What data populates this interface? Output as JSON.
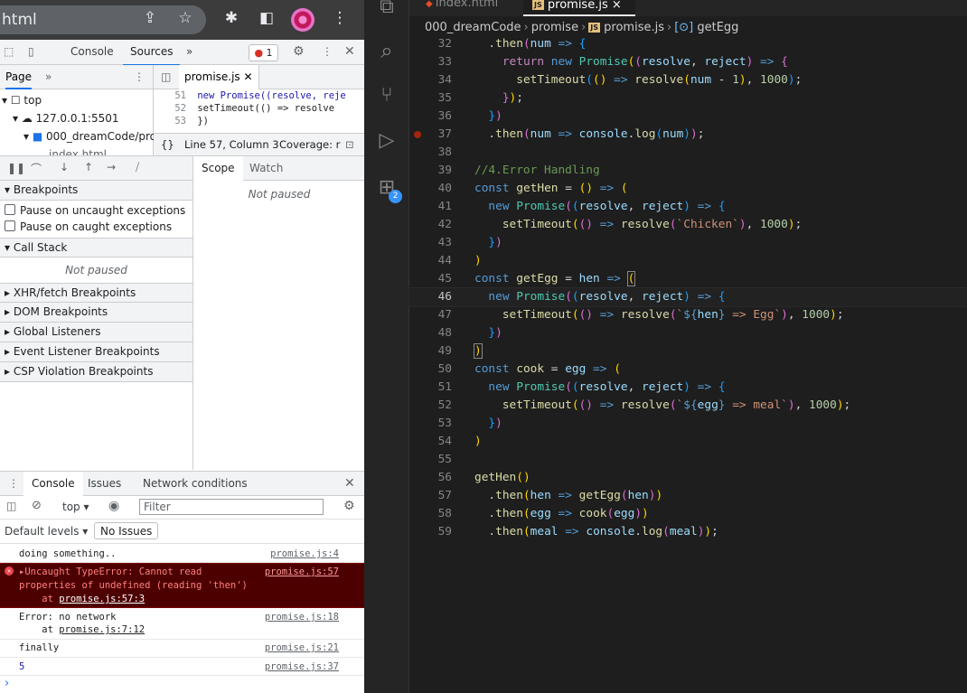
{
  "browser": {
    "omnibox_text": "html",
    "icons": [
      "share-icon",
      "star-icon",
      "extensions-icon",
      "side-panel-icon",
      "profile-avatar",
      "menu-icon"
    ]
  },
  "devtools": {
    "tabs": {
      "console": "Console",
      "sources": "Sources",
      "more": "»"
    },
    "error_count": "1",
    "navigator": {
      "page_tab": "Page",
      "more": "»",
      "tree": [
        {
          "label": "top"
        },
        {
          "label": "127.0.0.1:5501"
        },
        {
          "label": "000_dreamCode/pro"
        },
        {
          "label": "index.html"
        }
      ]
    },
    "editor": {
      "file_tab": "promise.js",
      "lines": [
        {
          "num": "51",
          "code": "  new Promise((resolve, reje"
        },
        {
          "num": "52",
          "code": "    setTimeout(() => resolve"
        },
        {
          "num": "53",
          "code": "  })"
        }
      ],
      "status_position": "Line 57, Column 3",
      "status_coverage": "Coverage: r",
      "status_braces": "{}"
    },
    "scope_tabs": {
      "scope": "Scope",
      "watch": "Watch"
    },
    "scope_not_paused": "Not paused",
    "sections": {
      "breakpoints": "Breakpoints",
      "pause_uncaught": "Pause on uncaught exceptions",
      "pause_caught": "Pause on caught exceptions",
      "call_stack": "Call Stack",
      "call_stack_note": "Not paused",
      "xhr": "XHR/fetch Breakpoints",
      "dom": "DOM Breakpoints",
      "global": "Global Listeners",
      "event": "Event Listener Breakpoints",
      "csp": "CSP Violation Breakpoints"
    },
    "drawer_tabs": {
      "console": "Console",
      "issues": "Issues",
      "network": "Network conditions"
    },
    "console_toolbar": {
      "context": "top",
      "filter_placeholder": "Filter",
      "levels": "Default levels",
      "issues": "No Issues"
    },
    "console_messages": [
      {
        "type": "log",
        "text": "doing something..",
        "source": "promise.js:4"
      },
      {
        "type": "error",
        "text1": "▸Uncaught TypeError: Cannot read",
        "text2": "properties of undefined (reading 'then')",
        "text3_prefix": "    at ",
        "text3_link": "promise.js:57:3",
        "source": "promise.js:57"
      },
      {
        "type": "log",
        "text1": "Error: no network",
        "text2_prefix": "    at ",
        "text2_link": "promise.js:7:12",
        "source": "promise.js:18"
      },
      {
        "type": "log",
        "text": "finally",
        "source": "promise.js:21"
      },
      {
        "type": "number",
        "text": "5",
        "source": "promise.js:37"
      }
    ],
    "prompt": "›"
  },
  "vscode": {
    "tabs": [
      {
        "label": "index.html"
      },
      {
        "label": "promise.js",
        "close": "×"
      }
    ],
    "breadcrumb": [
      "000_dreamCode",
      "promise",
      "promise.js",
      "getEgg"
    ],
    "js_badge": "JS",
    "activity_badge": "2",
    "colors": {
      "keyword": "#569cd6",
      "control": "#c586c0",
      "function": "#dcdcaa",
      "class": "#4ec9b0",
      "param": "#9cdcfe",
      "number": "#b5cea8",
      "string": "#ce9178",
      "comment": "#6a9955"
    },
    "code_lines": [
      "32",
      "33",
      "34",
      "35",
      "36",
      "37",
      "38",
      "39",
      "40",
      "41",
      "42",
      "43",
      "44",
      "45",
      "46",
      "47",
      "48",
      "49",
      "50",
      "51",
      "52",
      "53",
      "54",
      "55",
      "56",
      "57",
      "58",
      "59"
    ]
  }
}
